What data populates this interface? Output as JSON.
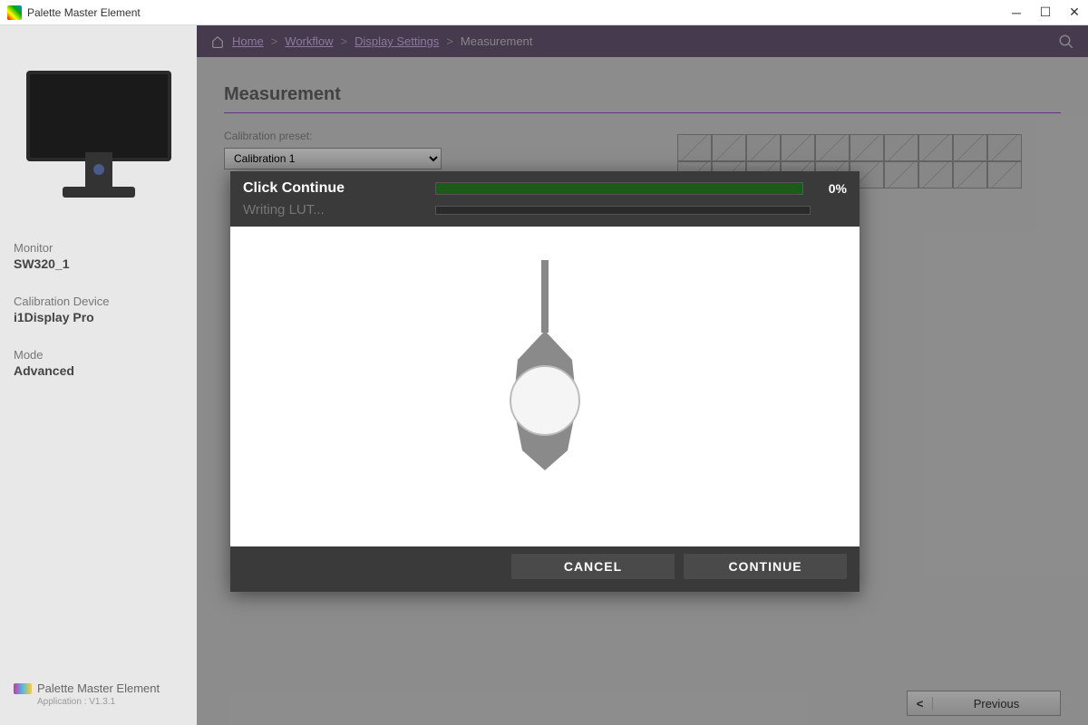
{
  "titlebar": {
    "title": "Palette Master Element"
  },
  "sidebar": {
    "monitor_label": "Monitor",
    "monitor_value": "SW320_1",
    "device_label": "Calibration Device",
    "device_value": "i1Display Pro",
    "mode_label": "Mode",
    "mode_value": "Advanced",
    "footer_name": "Palette Master Element",
    "footer_version": "Application : V1.3.1"
  },
  "breadcrumb": {
    "home": "Home",
    "workflow": "Workflow",
    "display_settings": "Display Settings",
    "measurement": "Measurement"
  },
  "page": {
    "title": "Measurement",
    "preset_label": "Calibration preset:",
    "preset_value": "Calibration 1"
  },
  "modal": {
    "title": "Click Continue",
    "subtitle": "Writing LUT...",
    "progress_pct": "0%",
    "cancel": "CANCEL",
    "continue": "CONTINUE"
  },
  "nav": {
    "previous": "Previous"
  }
}
